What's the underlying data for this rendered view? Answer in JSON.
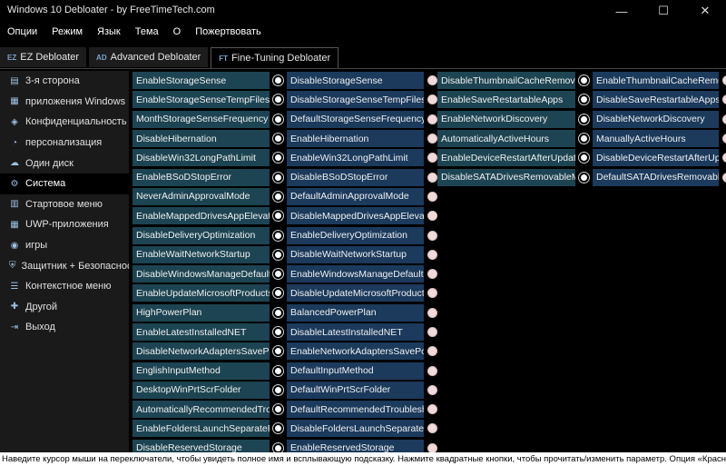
{
  "window": {
    "title": "Windows 10 Debloater - by FreeTimeTech.com"
  },
  "window_controls": [
    {
      "name": "minimize-button",
      "glyph": "—"
    },
    {
      "name": "maximize-button",
      "glyph": "☐"
    },
    {
      "name": "close-button",
      "glyph": "✕"
    }
  ],
  "menu": [
    "Опции",
    "Режим",
    "Язык",
    "Тема",
    "О",
    "Пожертвовать"
  ],
  "tabs": [
    {
      "abbr": "EZ",
      "label": "EZ Debloater",
      "active": false
    },
    {
      "abbr": "AD",
      "label": "Advanced Debloater",
      "active": false
    },
    {
      "abbr": "FT",
      "label": "Fine-Tuning Debloater",
      "active": true
    }
  ],
  "sidebar": [
    {
      "label": "3-я сторона",
      "icon": "package-icon",
      "glyph": "▤"
    },
    {
      "label": "приложения Windows",
      "icon": "windows-apps-icon",
      "glyph": "▦"
    },
    {
      "label": "Конфиденциальность",
      "icon": "shield-icon",
      "glyph": "◈"
    },
    {
      "label": "персонализация",
      "icon": "palette-icon",
      "glyph": "◔"
    },
    {
      "label": "Один диск",
      "icon": "cloud-icon",
      "glyph": "☁"
    },
    {
      "label": "Система",
      "icon": "gear-icon",
      "glyph": "⚙",
      "active": true
    },
    {
      "label": "Стартовое меню",
      "icon": "start-menu-icon",
      "glyph": "▥"
    },
    {
      "label": "UWP-приложения",
      "icon": "apps-grid-icon",
      "glyph": "▦"
    },
    {
      "label": "игры",
      "icon": "gamepad-icon",
      "glyph": "◉"
    },
    {
      "label": "Защитник + Безопасность",
      "icon": "defender-icon",
      "glyph": "⛨"
    },
    {
      "label": "Контекстное меню",
      "icon": "context-menu-icon",
      "glyph": "☰"
    },
    {
      "label": "Другой",
      "icon": "puzzle-icon",
      "glyph": "✚"
    },
    {
      "label": "Выход",
      "icon": "exit-icon",
      "glyph": "⇥"
    }
  ],
  "colors": {
    "teal": "#1d4452",
    "navy": "#1b3a5c",
    "accent": "#7aa3c7"
  },
  "columns": {
    "left": [
      {
        "a": "EnableStorageSense",
        "b": "DisableStorageSense",
        "sel": "b"
      },
      {
        "a": "EnableStorageSenseTempFiles",
        "b": "DisableStorageSenseTempFiles",
        "sel": "b"
      },
      {
        "a": "MonthStorageSenseFrequency",
        "b": "DefaultStorageSenseFrequency",
        "sel": "b"
      },
      {
        "a": "DisableHibernation",
        "b": "EnableHibernation",
        "sel": "b"
      },
      {
        "a": "DisableWin32LongPathLimit",
        "b": "EnableWin32LongPathLimit",
        "sel": "b"
      },
      {
        "a": "EnableBSoDStopError",
        "b": "DisableBSoDStopError",
        "sel": "b"
      },
      {
        "a": "NeverAdminApprovalMode",
        "b": "DefaultAdminApprovalMode",
        "sel": "b"
      },
      {
        "a": "EnableMappedDrivesAppElevatedAccess",
        "b": "DisableMappedDrivesAppElevatedAccess",
        "sel": "b"
      },
      {
        "a": "DisableDeliveryOptimization",
        "b": "EnableDeliveryOptimization",
        "sel": "b"
      },
      {
        "a": "EnableWaitNetworkStartup",
        "b": "DisableWaitNetworkStartup",
        "sel": "b"
      },
      {
        "a": "DisableWindowsManageDefaultPrinter",
        "b": "EnableWindowsManageDefaultPrinter",
        "sel": "b"
      },
      {
        "a": "EnableUpdateMicrosoftProducts",
        "b": "DisableUpdateMicrosoftProducts",
        "sel": "b"
      },
      {
        "a": "HighPowerPlan",
        "b": "BalancedPowerPlan",
        "sel": "b"
      },
      {
        "a": "EnableLatestInstalledNET",
        "b": "DisableLatestInstalledNET",
        "sel": "b"
      },
      {
        "a": "DisableNetworkAdaptersSavePower",
        "b": "EnableNetworkAdaptersSavePower",
        "sel": "b"
      },
      {
        "a": "EnglishInputMethod",
        "b": "DefaultInputMethod",
        "sel": "b"
      },
      {
        "a": "DesktopWinPrtScrFolder",
        "b": "DefaultWinPrtScrFolder",
        "sel": "b"
      },
      {
        "a": "AutomaticallyRecommendedTroubleshooting",
        "b": "DefaultRecommendedTroubleshooting",
        "sel": "b"
      },
      {
        "a": "EnableFoldersLaunchSeparateProcess",
        "b": "DisableFoldersLaunchSeparateProcess",
        "sel": "b"
      },
      {
        "a": "DisableReservedStorage",
        "b": "EnableReservedStorage",
        "sel": "b"
      }
    ],
    "right": [
      {
        "a": "DisableThumbnailCacheRemoval",
        "b": "EnableThumbnailCacheRemoval",
        "sel": "b"
      },
      {
        "a": "EnableSaveRestartableApps",
        "b": "DisableSaveRestartableApps",
        "sel": "b"
      },
      {
        "a": "EnableNetworkDiscovery",
        "b": "DisableNetworkDiscovery",
        "sel": "b"
      },
      {
        "a": "AutomaticallyActiveHours",
        "b": "ManuallyActiveHours",
        "sel": "b"
      },
      {
        "a": "EnableDeviceRestartAfterUpdate",
        "b": "DisableDeviceRestartAfterUpdate",
        "sel": "b"
      },
      {
        "a": "DisableSATADrivesRemovableMedia",
        "b": "DefaultSATADrivesRemovableMedia",
        "sel": "b"
      }
    ]
  },
  "status": "Наведите курсор мыши на переключатели, чтобы увидеть полное имя и всплывающую подсказку. Нажмите квадратные кнопки, чтобы прочитать/изменить параметр. Опция «Красный круг» означает, что ничего не выбрано."
}
